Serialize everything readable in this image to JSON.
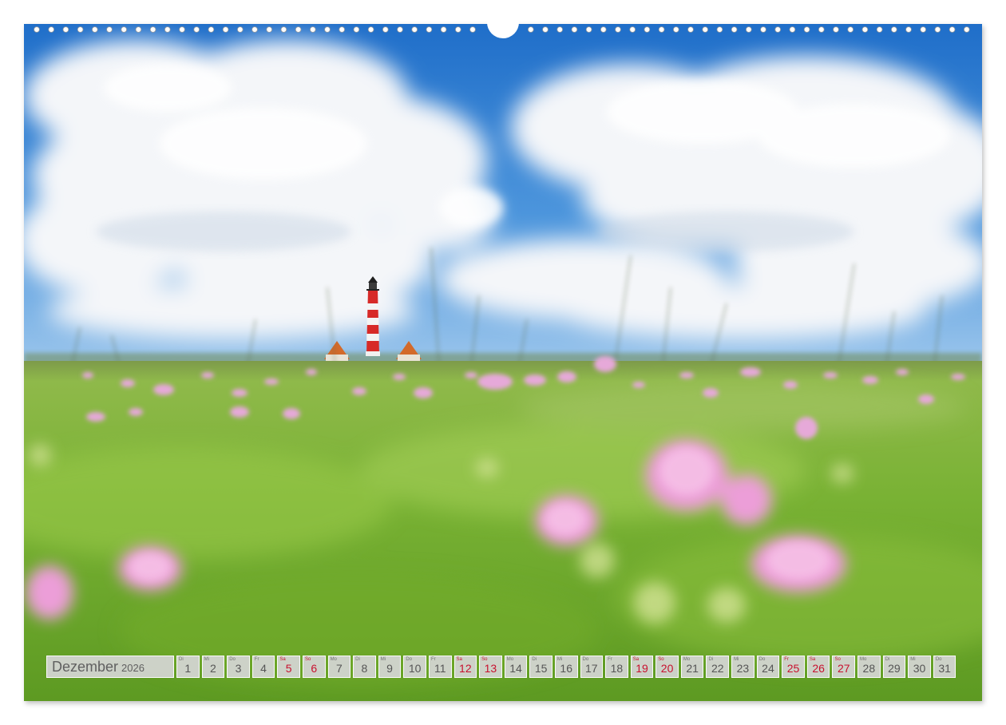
{
  "calendar": {
    "month": "Dezember",
    "year": "2026",
    "days": [
      {
        "wd": "Di",
        "n": "1",
        "red": false
      },
      {
        "wd": "Mi",
        "n": "2",
        "red": false
      },
      {
        "wd": "Do",
        "n": "3",
        "red": false
      },
      {
        "wd": "Fr",
        "n": "4",
        "red": false
      },
      {
        "wd": "Sa",
        "n": "5",
        "red": true
      },
      {
        "wd": "So",
        "n": "6",
        "red": true
      },
      {
        "wd": "Mo",
        "n": "7",
        "red": false
      },
      {
        "wd": "Di",
        "n": "8",
        "red": false
      },
      {
        "wd": "Mi",
        "n": "9",
        "red": false
      },
      {
        "wd": "Do",
        "n": "10",
        "red": false
      },
      {
        "wd": "Fr",
        "n": "11",
        "red": false
      },
      {
        "wd": "Sa",
        "n": "12",
        "red": true
      },
      {
        "wd": "So",
        "n": "13",
        "red": true
      },
      {
        "wd": "Mo",
        "n": "14",
        "red": false
      },
      {
        "wd": "Di",
        "n": "15",
        "red": false
      },
      {
        "wd": "Mi",
        "n": "16",
        "red": false
      },
      {
        "wd": "Do",
        "n": "17",
        "red": false
      },
      {
        "wd": "Fr",
        "n": "18",
        "red": false
      },
      {
        "wd": "Sa",
        "n": "19",
        "red": true
      },
      {
        "wd": "So",
        "n": "20",
        "red": true
      },
      {
        "wd": "Mo",
        "n": "21",
        "red": false
      },
      {
        "wd": "Di",
        "n": "22",
        "red": false
      },
      {
        "wd": "Mi",
        "n": "23",
        "red": false
      },
      {
        "wd": "Do",
        "n": "24",
        "red": false
      },
      {
        "wd": "Fr",
        "n": "25",
        "red": true
      },
      {
        "wd": "Sa",
        "n": "26",
        "red": true
      },
      {
        "wd": "So",
        "n": "27",
        "red": true
      },
      {
        "wd": "Mo",
        "n": "28",
        "red": false
      },
      {
        "wd": "Di",
        "n": "29",
        "red": false
      },
      {
        "wd": "Mi",
        "n": "30",
        "red": false
      },
      {
        "wd": "Do",
        "n": "31",
        "red": false
      }
    ]
  },
  "colors": {
    "sky": "#2a7fd4",
    "meadow": "#6fae2e",
    "blossom": "#e9a6d6",
    "holiday_red": "#c8102e",
    "cell_gray": "#d6d6d6"
  },
  "photo": {
    "subject": "lighthouse-with-two-houses-behind-flower-meadow"
  }
}
